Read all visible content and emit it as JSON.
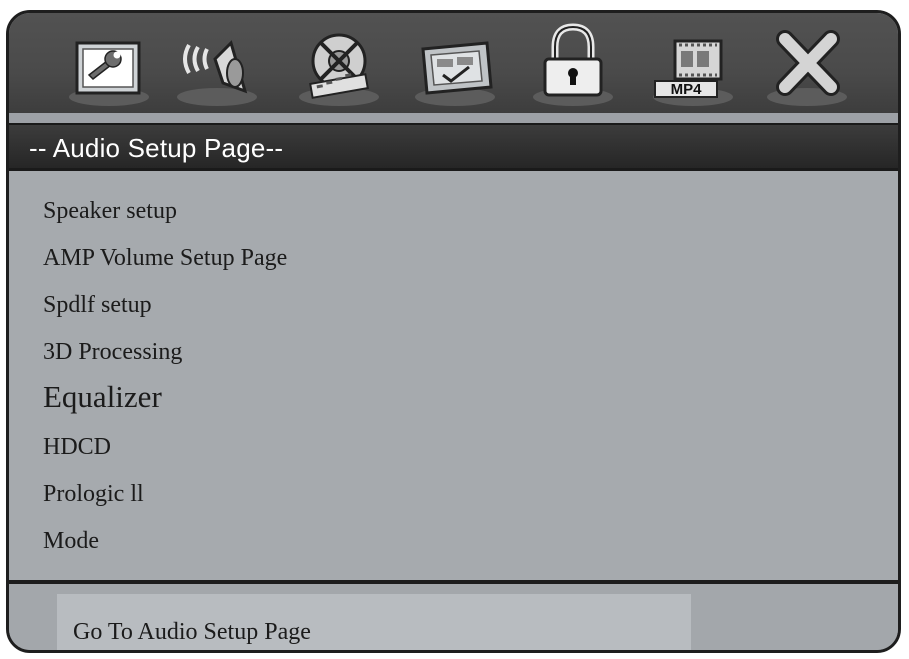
{
  "tabs": [
    {
      "icon": "general-setup-icon"
    },
    {
      "icon": "audio-speaker-icon"
    },
    {
      "icon": "video-film-icon"
    },
    {
      "icon": "preference-icon"
    },
    {
      "icon": "password-lock-icon"
    },
    {
      "icon": "mp4-icon",
      "badge": "MP4"
    },
    {
      "icon": "exit-icon"
    }
  ],
  "page_title": "-- Audio Setup Page--",
  "menu": [
    "Speaker setup",
    "AMP Volume Setup Page",
    "Spdlf setup",
    "3D Processing",
    "Equalizer",
    "HDCD",
    "Prologic ll",
    "Mode"
  ],
  "status_text": "Go To Audio Setup Page"
}
